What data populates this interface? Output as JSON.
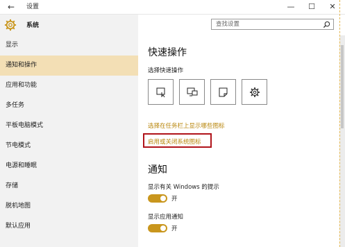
{
  "window": {
    "title": "设置",
    "back_icon": "←",
    "min_icon": "—",
    "max_icon": "☐",
    "close_icon": "✕"
  },
  "header": {
    "section": "系统",
    "search_placeholder": "查找设置"
  },
  "sidebar": {
    "items": [
      {
        "label": "显示"
      },
      {
        "label": "通知和操作",
        "active": true
      },
      {
        "label": "应用和功能"
      },
      {
        "label": "多任务"
      },
      {
        "label": "平板电脑模式"
      },
      {
        "label": "节电模式"
      },
      {
        "label": "电源和睡眠"
      },
      {
        "label": "存储"
      },
      {
        "label": "脱机地图"
      },
      {
        "label": "默认应用"
      }
    ]
  },
  "main": {
    "quick_actions_title": "快速操作",
    "choose_quick_actions": "选择快速操作",
    "tiles": [
      "tablet-mode-icon",
      "project-icon",
      "note-icon",
      "settings-icon"
    ],
    "link_taskbar_icons": "选择在任务栏上显示哪些图标",
    "link_system_icons": "启用或关闭系统图标",
    "notifications_title": "通知",
    "show_windows_tips_label": "显示有关 Windows 的提示",
    "show_windows_tips_state": "开",
    "show_app_notifications_label": "显示应用通知",
    "show_app_notifications_state": "开"
  },
  "colors": {
    "accent": "#c9961d",
    "link": "#b8860b",
    "active_nav": "#f3dfb5",
    "highlight_box": "#b0131a"
  }
}
